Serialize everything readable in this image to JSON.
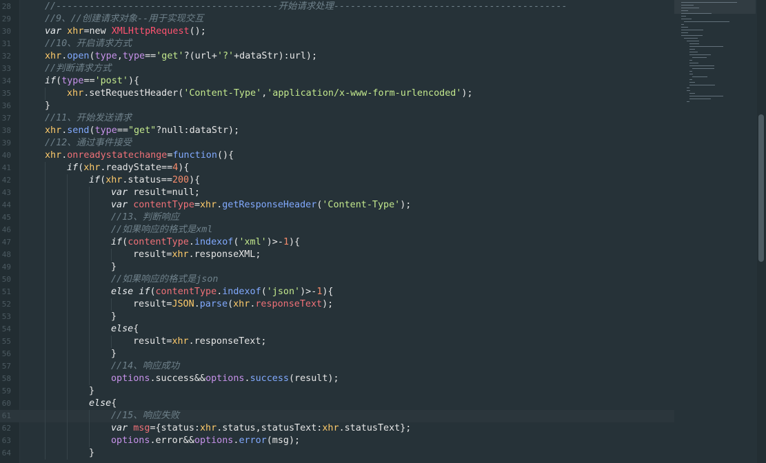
{
  "editor": {
    "lines": [
      {
        "number": "28",
        "active": false,
        "indent": 0,
        "tokens": [
          {
            "t": "//----------------------------------------开始请求处理------------------------------------------",
            "c": "comment"
          }
        ]
      },
      {
        "number": "29",
        "active": false,
        "indent": 0,
        "tokens": [
          {
            "t": "//9、//创建请求对象--用于实现交互",
            "c": "comment"
          }
        ]
      },
      {
        "number": "30",
        "active": false,
        "indent": 0,
        "tokens": [
          {
            "t": "var",
            "c": "kw"
          },
          {
            "t": " ",
            "c": "plain"
          },
          {
            "t": "xhr",
            "c": "obj"
          },
          {
            "t": "=new ",
            "c": "plain"
          },
          {
            "t": "XMLHttpRequest",
            "c": "builtin"
          },
          {
            "t": "();",
            "c": "plain"
          }
        ]
      },
      {
        "number": "31",
        "active": false,
        "indent": 0,
        "tokens": [
          {
            "t": "//10、开启请求方式",
            "c": "comment"
          }
        ]
      },
      {
        "number": "32",
        "active": false,
        "indent": 0,
        "tokens": [
          {
            "t": "xhr",
            "c": "obj"
          },
          {
            "t": ".",
            "c": "plain"
          },
          {
            "t": "open",
            "c": "func"
          },
          {
            "t": "(",
            "c": "plain"
          },
          {
            "t": "type",
            "c": "param"
          },
          {
            "t": ",",
            "c": "plain"
          },
          {
            "t": "type",
            "c": "param"
          },
          {
            "t": "==",
            "c": "plain"
          },
          {
            "t": "'get'",
            "c": "string"
          },
          {
            "t": "?(url+",
            "c": "plain"
          },
          {
            "t": "'?'",
            "c": "string"
          },
          {
            "t": "+dataStr):url);",
            "c": "plain"
          }
        ]
      },
      {
        "number": "33",
        "active": false,
        "indent": 0,
        "tokens": [
          {
            "t": "//判断请求方式",
            "c": "comment"
          }
        ]
      },
      {
        "number": "34",
        "active": false,
        "indent": 0,
        "tokens": [
          {
            "t": "if",
            "c": "kw"
          },
          {
            "t": "(",
            "c": "plain"
          },
          {
            "t": "type",
            "c": "param"
          },
          {
            "t": "==",
            "c": "plain"
          },
          {
            "t": "'post'",
            "c": "string"
          },
          {
            "t": "){",
            "c": "plain"
          }
        ]
      },
      {
        "number": "35",
        "active": false,
        "indent": 1,
        "tokens": [
          {
            "t": "xhr",
            "c": "obj"
          },
          {
            "t": ".setRequestHeader(",
            "c": "plain"
          },
          {
            "t": "'Content-Type'",
            "c": "string"
          },
          {
            "t": ",",
            "c": "plain"
          },
          {
            "t": "'application/x-www-form-urlencoded'",
            "c": "string"
          },
          {
            "t": ");",
            "c": "plain"
          }
        ]
      },
      {
        "number": "36",
        "active": false,
        "indent": 0,
        "tokens": [
          {
            "t": "}",
            "c": "plain"
          }
        ]
      },
      {
        "number": "37",
        "active": false,
        "indent": 0,
        "tokens": [
          {
            "t": "//11、开始发送请求",
            "c": "comment"
          }
        ]
      },
      {
        "number": "38",
        "active": false,
        "indent": 0,
        "tokens": [
          {
            "t": "xhr",
            "c": "obj"
          },
          {
            "t": ".",
            "c": "plain"
          },
          {
            "t": "send",
            "c": "func"
          },
          {
            "t": "(",
            "c": "plain"
          },
          {
            "t": "type",
            "c": "param"
          },
          {
            "t": "==",
            "c": "plain"
          },
          {
            "t": "\"get\"",
            "c": "string"
          },
          {
            "t": "?null:dataStr);",
            "c": "plain"
          }
        ]
      },
      {
        "number": "39",
        "active": false,
        "indent": 0,
        "tokens": [
          {
            "t": "//12、通过事件接受",
            "c": "comment"
          }
        ]
      },
      {
        "number": "40",
        "active": false,
        "indent": 0,
        "tokens": [
          {
            "t": "xhr",
            "c": "obj"
          },
          {
            "t": ".",
            "c": "plain"
          },
          {
            "t": "onreadystatechange",
            "c": "var"
          },
          {
            "t": "=",
            "c": "plain"
          },
          {
            "t": "function",
            "c": "func"
          },
          {
            "t": "(){",
            "c": "plain"
          }
        ]
      },
      {
        "number": "41",
        "active": false,
        "indent": 1,
        "tokens": [
          {
            "t": "if",
            "c": "kw"
          },
          {
            "t": "(",
            "c": "plain"
          },
          {
            "t": "xhr",
            "c": "obj"
          },
          {
            "t": ".readyState==",
            "c": "plain"
          },
          {
            "t": "4",
            "c": "number"
          },
          {
            "t": "){",
            "c": "plain"
          }
        ]
      },
      {
        "number": "42",
        "active": false,
        "indent": 2,
        "tokens": [
          {
            "t": "if",
            "c": "kw"
          },
          {
            "t": "(",
            "c": "plain"
          },
          {
            "t": "xhr",
            "c": "obj"
          },
          {
            "t": ".status==",
            "c": "plain"
          },
          {
            "t": "200",
            "c": "number"
          },
          {
            "t": "){",
            "c": "plain"
          }
        ]
      },
      {
        "number": "43",
        "active": false,
        "indent": 3,
        "tokens": [
          {
            "t": "var",
            "c": "kw"
          },
          {
            "t": " result=null;",
            "c": "plain"
          }
        ]
      },
      {
        "number": "44",
        "active": false,
        "indent": 3,
        "tokens": [
          {
            "t": "var",
            "c": "kw"
          },
          {
            "t": " ",
            "c": "plain"
          },
          {
            "t": "contentType",
            "c": "var"
          },
          {
            "t": "=",
            "c": "plain"
          },
          {
            "t": "xhr",
            "c": "obj"
          },
          {
            "t": ".",
            "c": "plain"
          },
          {
            "t": "getResponseHeader",
            "c": "func"
          },
          {
            "t": "(",
            "c": "plain"
          },
          {
            "t": "'Content-Type'",
            "c": "string"
          },
          {
            "t": ");",
            "c": "plain"
          }
        ]
      },
      {
        "number": "45",
        "active": false,
        "indent": 3,
        "tokens": [
          {
            "t": "//13、判断响应",
            "c": "comment"
          }
        ]
      },
      {
        "number": "46",
        "active": false,
        "indent": 3,
        "tokens": [
          {
            "t": "//如果响应的格式是xml",
            "c": "comment"
          }
        ]
      },
      {
        "number": "47",
        "active": false,
        "indent": 3,
        "tokens": [
          {
            "t": "if",
            "c": "kw"
          },
          {
            "t": "(",
            "c": "plain"
          },
          {
            "t": "contentType",
            "c": "var"
          },
          {
            "t": ".",
            "c": "plain"
          },
          {
            "t": "indexof",
            "c": "func"
          },
          {
            "t": "(",
            "c": "plain"
          },
          {
            "t": "'xml'",
            "c": "string"
          },
          {
            "t": ")>-",
            "c": "plain"
          },
          {
            "t": "1",
            "c": "number"
          },
          {
            "t": "){",
            "c": "plain"
          }
        ]
      },
      {
        "number": "48",
        "active": false,
        "indent": 4,
        "tokens": [
          {
            "t": "result=",
            "c": "plain"
          },
          {
            "t": "xhr",
            "c": "obj"
          },
          {
            "t": ".responseXML;",
            "c": "plain"
          }
        ]
      },
      {
        "number": "49",
        "active": false,
        "indent": 3,
        "tokens": [
          {
            "t": "}",
            "c": "plain"
          }
        ]
      },
      {
        "number": "50",
        "active": false,
        "indent": 3,
        "tokens": [
          {
            "t": "//如果响应的格式是json",
            "c": "comment"
          }
        ]
      },
      {
        "number": "51",
        "active": false,
        "indent": 3,
        "tokens": [
          {
            "t": "else",
            "c": "kw"
          },
          {
            "t": " ",
            "c": "plain"
          },
          {
            "t": "if",
            "c": "kw"
          },
          {
            "t": "(",
            "c": "plain"
          },
          {
            "t": "contentType",
            "c": "var"
          },
          {
            "t": ".",
            "c": "plain"
          },
          {
            "t": "indexof",
            "c": "func"
          },
          {
            "t": "(",
            "c": "plain"
          },
          {
            "t": "'json'",
            "c": "string"
          },
          {
            "t": ")>-",
            "c": "plain"
          },
          {
            "t": "1",
            "c": "number"
          },
          {
            "t": "){",
            "c": "plain"
          }
        ]
      },
      {
        "number": "52",
        "active": false,
        "indent": 4,
        "tokens": [
          {
            "t": "result=",
            "c": "plain"
          },
          {
            "t": "JSON",
            "c": "obj"
          },
          {
            "t": ".",
            "c": "plain"
          },
          {
            "t": "parse",
            "c": "func"
          },
          {
            "t": "(",
            "c": "plain"
          },
          {
            "t": "xhr",
            "c": "obj"
          },
          {
            "t": ".",
            "c": "plain"
          },
          {
            "t": "responseText",
            "c": "var"
          },
          {
            "t": ");",
            "c": "plain"
          }
        ]
      },
      {
        "number": "53",
        "active": false,
        "indent": 3,
        "tokens": [
          {
            "t": "}",
            "c": "plain"
          }
        ]
      },
      {
        "number": "54",
        "active": false,
        "indent": 3,
        "tokens": [
          {
            "t": "else",
            "c": "kw"
          },
          {
            "t": "{",
            "c": "plain"
          }
        ]
      },
      {
        "number": "55",
        "active": false,
        "indent": 4,
        "tokens": [
          {
            "t": "result=",
            "c": "plain"
          },
          {
            "t": "xhr",
            "c": "obj"
          },
          {
            "t": ".responseText;",
            "c": "plain"
          }
        ]
      },
      {
        "number": "56",
        "active": false,
        "indent": 3,
        "tokens": [
          {
            "t": "}",
            "c": "plain"
          }
        ]
      },
      {
        "number": "57",
        "active": false,
        "indent": 3,
        "tokens": [
          {
            "t": "//14、响应成功",
            "c": "comment"
          }
        ]
      },
      {
        "number": "58",
        "active": false,
        "indent": 3,
        "tokens": [
          {
            "t": "options",
            "c": "param"
          },
          {
            "t": ".success&&",
            "c": "plain"
          },
          {
            "t": "options",
            "c": "param"
          },
          {
            "t": ".",
            "c": "plain"
          },
          {
            "t": "success",
            "c": "func"
          },
          {
            "t": "(result);",
            "c": "plain"
          }
        ]
      },
      {
        "number": "59",
        "active": false,
        "indent": 2,
        "tokens": [
          {
            "t": "}",
            "c": "plain"
          }
        ]
      },
      {
        "number": "60",
        "active": false,
        "indent": 2,
        "tokens": [
          {
            "t": "else",
            "c": "kw"
          },
          {
            "t": "{",
            "c": "plain"
          }
        ]
      },
      {
        "number": "61",
        "active": true,
        "indent": 3,
        "tokens": [
          {
            "t": "//15、响应失败",
            "c": "comment"
          }
        ]
      },
      {
        "number": "62",
        "active": false,
        "indent": 3,
        "tokens": [
          {
            "t": "var",
            "c": "kw"
          },
          {
            "t": " ",
            "c": "plain"
          },
          {
            "t": "msg",
            "c": "var"
          },
          {
            "t": "={status:",
            "c": "plain"
          },
          {
            "t": "xhr",
            "c": "obj"
          },
          {
            "t": ".status,statusText:",
            "c": "plain"
          },
          {
            "t": "xhr",
            "c": "obj"
          },
          {
            "t": ".statusText};",
            "c": "plain"
          }
        ]
      },
      {
        "number": "63",
        "active": false,
        "indent": 3,
        "tokens": [
          {
            "t": "options",
            "c": "param"
          },
          {
            "t": ".error&&",
            "c": "plain"
          },
          {
            "t": "options",
            "c": "param"
          },
          {
            "t": ".",
            "c": "plain"
          },
          {
            "t": "error",
            "c": "func"
          },
          {
            "t": "(msg);",
            "c": "plain"
          }
        ]
      },
      {
        "number": "64",
        "active": false,
        "indent": 2,
        "tokens": [
          {
            "t": "}",
            "c": "plain"
          }
        ]
      }
    ]
  },
  "colors": {
    "background": "#263238",
    "gutter": "#222d32",
    "comment": "#6e808a",
    "string": "#c3e88d",
    "number": "#f78c6c",
    "function": "#82aaff",
    "builtin": "#ff5370",
    "parameter": "#c792ea",
    "variable": "#f07178",
    "object": "#ffcb6b"
  }
}
